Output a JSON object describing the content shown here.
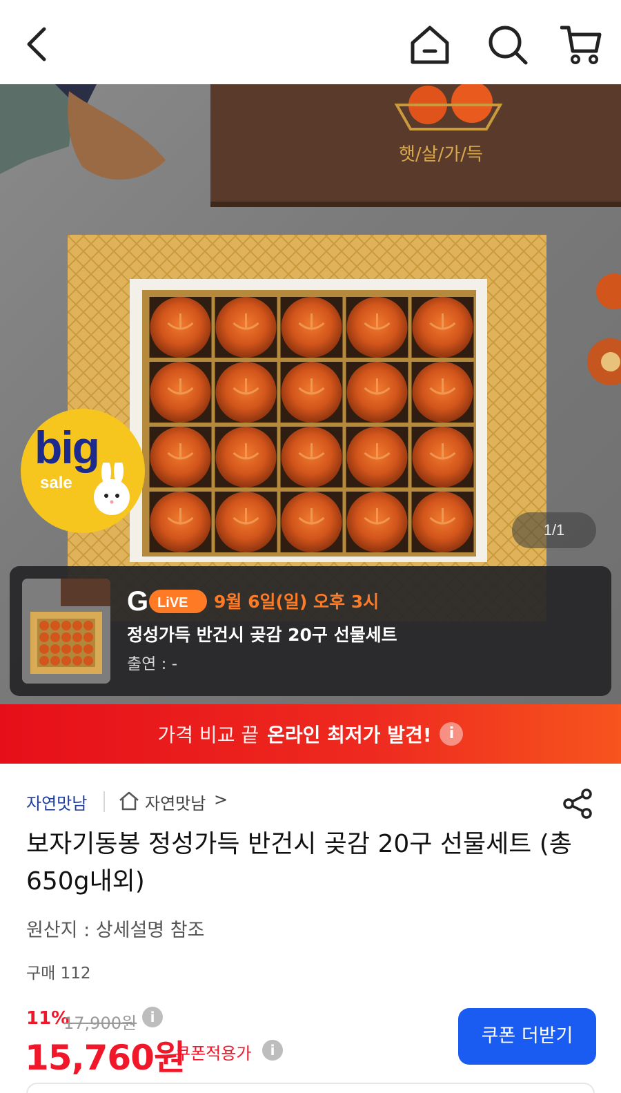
{
  "header": {
    "back_icon": "chevron-left-icon",
    "home_icon": "home-icon",
    "search_icon": "search-icon",
    "cart_icon": "cart-icon"
  },
  "hero": {
    "box_text": "햇/살/가/득",
    "counter": "1/1",
    "badge": {
      "big": "big",
      "sale": "sale"
    }
  },
  "live": {
    "logo_g": "G",
    "logo_live": "LiVE",
    "date": "9월 6일(일) 오후 3시",
    "title": "정성가득 반건시 곶감 20구 선물세트",
    "cast": "출연 : -"
  },
  "price_banner": {
    "pre": "가격 비교 끝",
    "strong": "온라인 최저가 발견!",
    "info": "i"
  },
  "product": {
    "brand": "자연맛남",
    "shop_name": "자연맛남",
    "shop_chevron": ">",
    "title": "보자기동봉 정성가득 반건시 곶감 20구 선물세트 (총650g내외)",
    "origin": "원산지 : 상세설명 참조",
    "buy_count": "구매 112",
    "discount": "11%",
    "original_price": "17,900원",
    "final_price": "15,760원",
    "coupon_label": "쿠폰적용가",
    "info": "i",
    "coupon_button": "쿠폰 더받기"
  },
  "colors": {
    "accent_red": "#f0172a",
    "button_blue": "#1a5cf2",
    "brand_blue": "#1e3d9c",
    "live_orange": "#ff7a24"
  }
}
